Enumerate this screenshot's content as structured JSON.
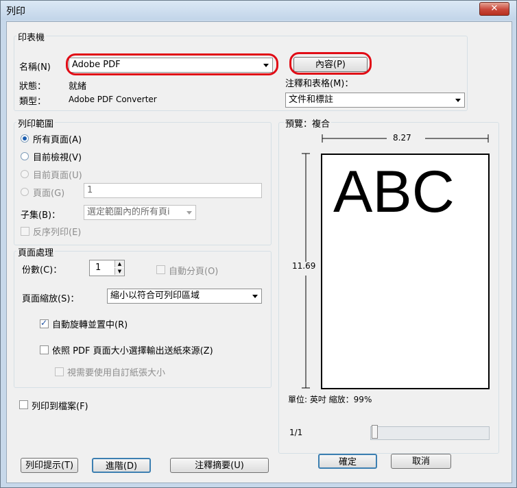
{
  "window": {
    "title": "列印",
    "close_glyph": "✕"
  },
  "printer": {
    "group_label": "印表機",
    "name_label": "名稱(N)",
    "name_value": "Adobe PDF",
    "properties_button": "內容(P)",
    "status_label": "狀態：",
    "status_value": "就緒",
    "type_label": "類型：",
    "type_value": "Adobe PDF Converter",
    "comments_label": "注釋和表格(M)：",
    "comments_value": "文件和標註"
  },
  "range": {
    "group_label": "列印範圍",
    "all_pages": "所有頁面(A)",
    "current_view": "目前檢視(V)",
    "current_page": "目前頁面(U)",
    "pages": "頁面(G)",
    "pages_value": "1",
    "subset_label": "子集(B)：",
    "subset_value": "選定範圍內的所有頁i",
    "reverse": "反序列印(E)"
  },
  "handling": {
    "group_label": "頁面處理",
    "copies_label": "份數(C)：",
    "copies_value": "1",
    "collate": "自動分頁(O)",
    "scaling_label": "頁面縮放(S)：",
    "scaling_value": "縮小以符合可列印區域",
    "auto_rotate": "自動旋轉並置中(R)",
    "choose_source": "依照 PDF 頁面大小選擇輸出送紙來源(Z)",
    "custom_paper": "視需要使用自訂紙張大小"
  },
  "print_to_file": "列印到檔案(F)",
  "preview": {
    "label": "預覽：複合",
    "width": "8.27",
    "height": "11.69",
    "sample_text": "ABC",
    "units": "單位: 英吋 縮放：99%",
    "page_indicator": "1/1"
  },
  "buttons": {
    "tips": "列印提示(T)",
    "advanced": "進階(D)",
    "summarize": "注釋摘要(U)",
    "ok": "確定",
    "cancel": "取消"
  },
  "colors": {
    "highlight": "#e10c16",
    "accent": "#1d5fb0"
  }
}
